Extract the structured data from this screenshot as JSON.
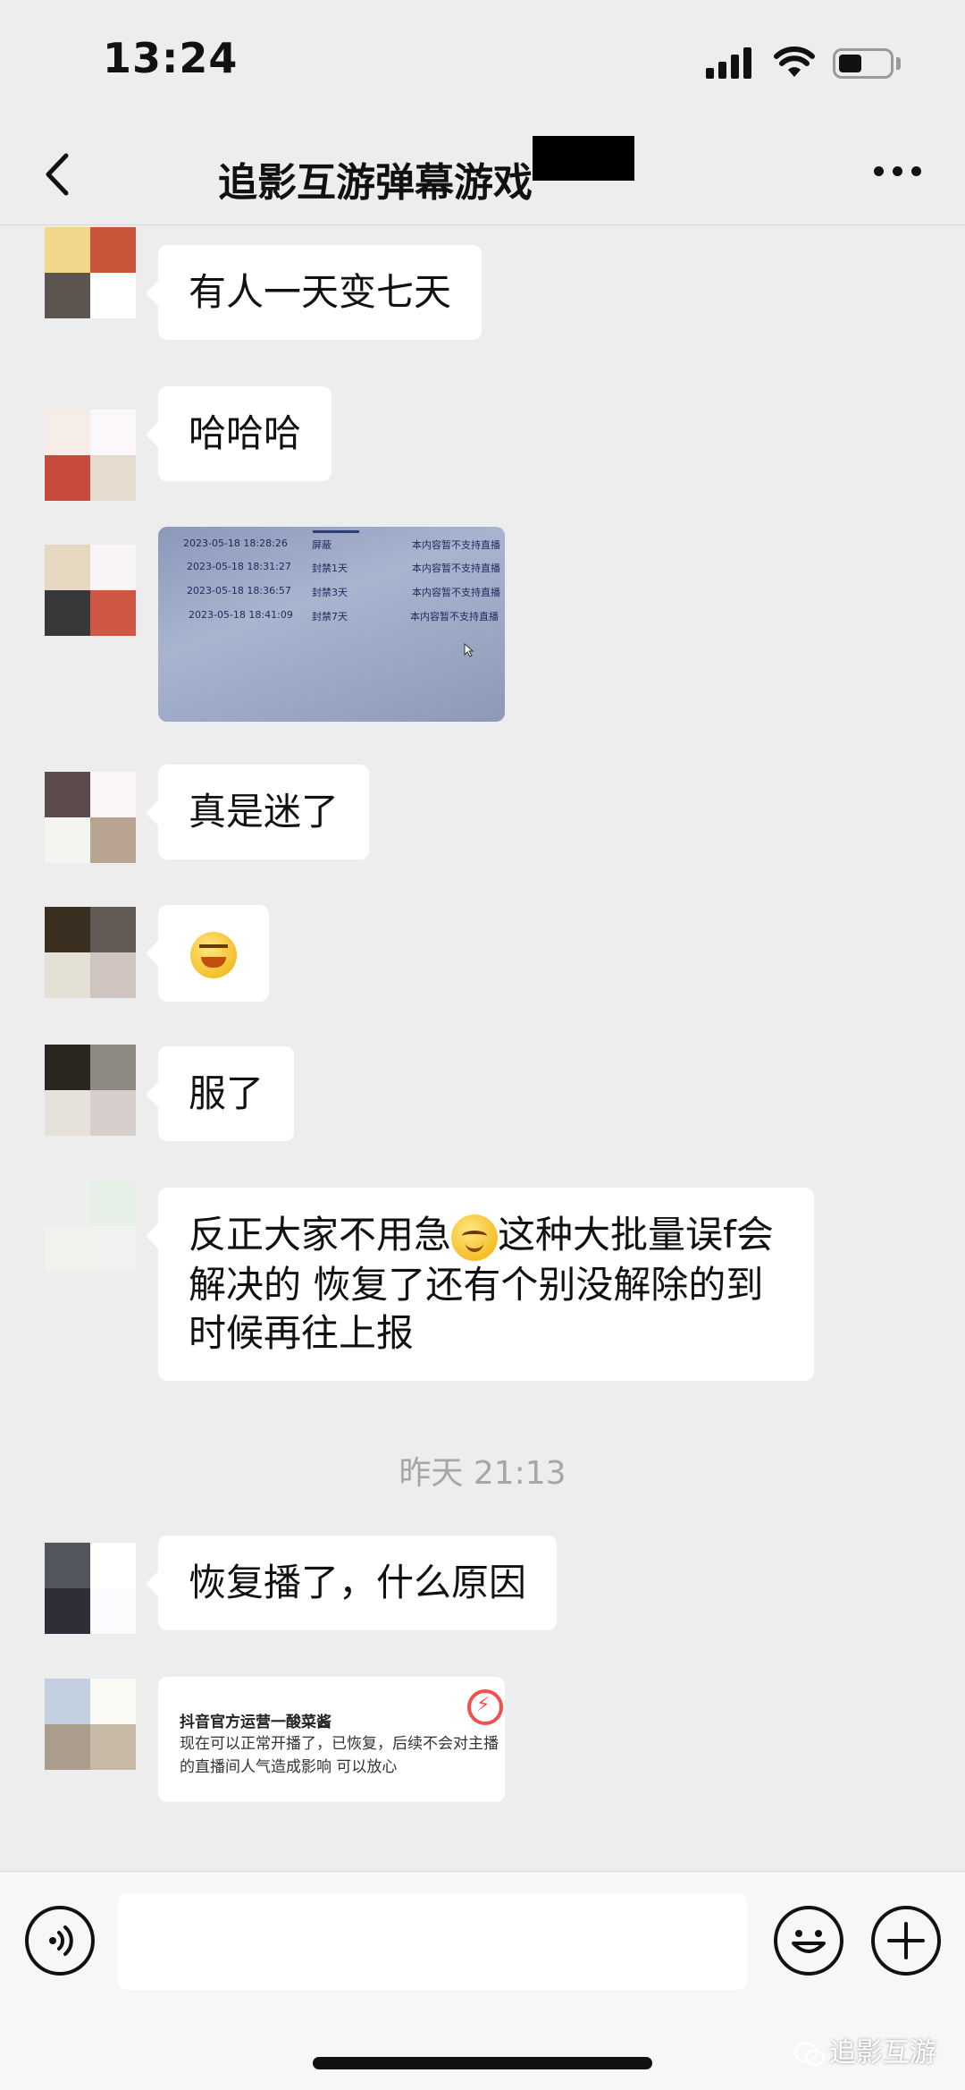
{
  "status": {
    "time": "13:24",
    "battery_level": 0.45
  },
  "nav": {
    "title": "追影互游弹幕游戏"
  },
  "messages": {
    "m1": "有人一天变七天",
    "m2": "哈哈哈",
    "m4": "真是迷了",
    "m6": "服了",
    "m7_a": "反正大家不用急",
    "m7_b": "这种大批量误f会解决的 恢复了还有个别没解除的到时候再往上报",
    "divider": "昨天 21:13",
    "m8": "恢复播了，什么原因"
  },
  "screenshot_table": {
    "header": {
      "date": "2023-05-18 18:28:26",
      "status": "屏蔽",
      "reason": "本内容暂不支持直播"
    },
    "rows": [
      {
        "date": "2023-05-18 18:31:27",
        "status": "封禁1天",
        "reason": "本内容暂不支持直播"
      },
      {
        "date": "2023-05-18 18:36:57",
        "status": "封禁3天",
        "reason": "本内容暂不支持直播"
      },
      {
        "date": "2023-05-18 18:41:09",
        "status": "封禁7天",
        "reason": "本内容暂不支持直播"
      }
    ]
  },
  "notice": {
    "title": "抖音官方运营一酸菜酱",
    "body": "现在可以正常开播了，已恢复，后续不会对主播的直播间人气造成影响 可以放心"
  },
  "icons": {
    "back": "chevron-left-icon",
    "more": "more-dots-icon",
    "voice": "voice-icon",
    "emoji": "emoji-icon",
    "plus": "plus-icon",
    "emoji_angry": "angry-face-emoji",
    "emoji_pleading": "pleading-face-emoji"
  },
  "watermark": {
    "text": "追影互游"
  },
  "colors": {
    "background": "#ededed",
    "bubble": "#ffffff",
    "input_bar": "#f7f7f7"
  }
}
